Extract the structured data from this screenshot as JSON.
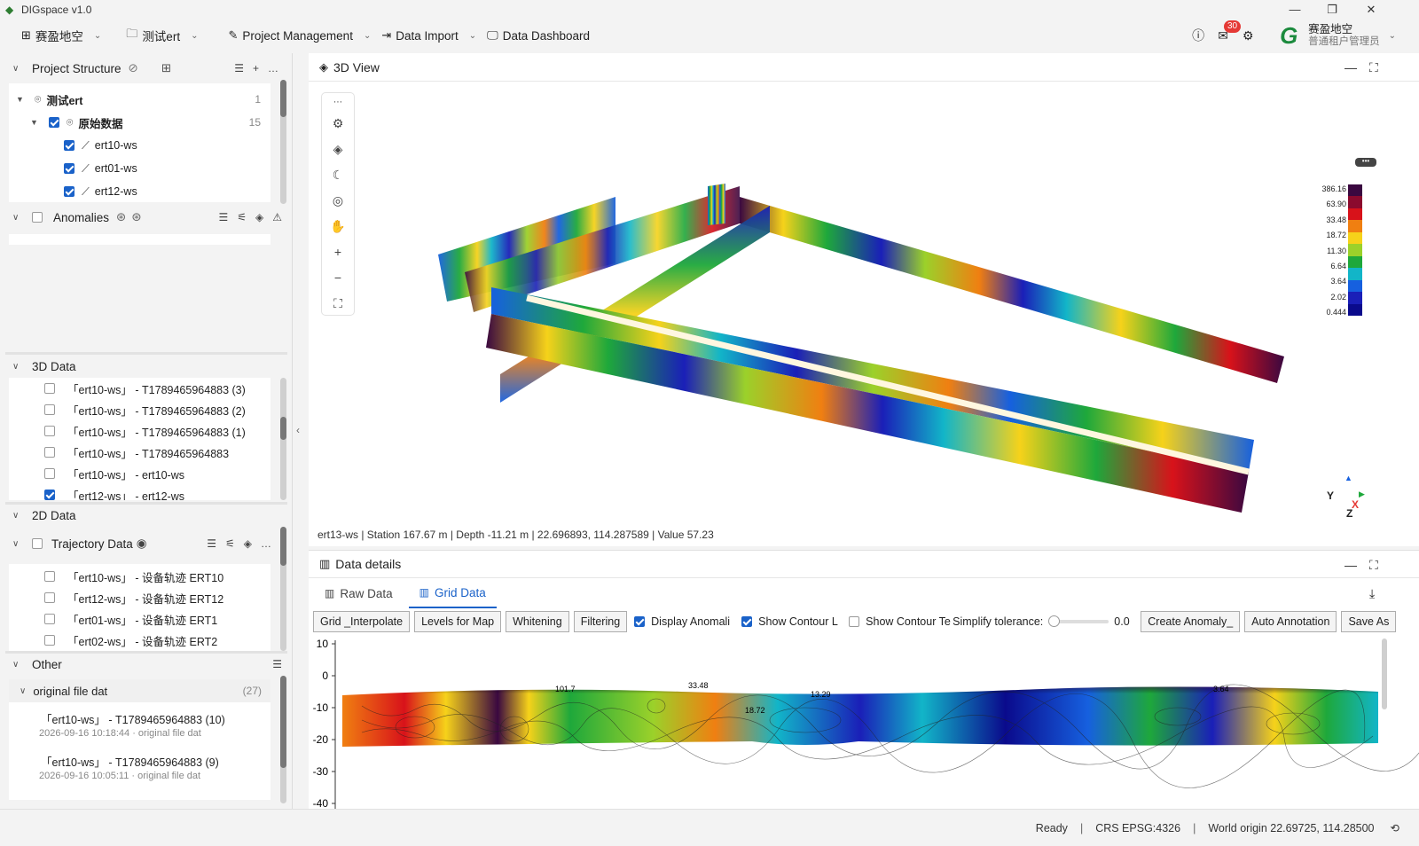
{
  "app": {
    "title": "DIGspace v1.0"
  },
  "window": {
    "minimize": "—",
    "restore": "❐",
    "close": "✕"
  },
  "menu": {
    "workspace": "赛盈地空",
    "project": "测试ert",
    "project_management": "Project Management",
    "data_import": "Data Import",
    "data_dashboard": "Data Dashboard"
  },
  "header": {
    "notif_count": "30",
    "user_name": "赛盈地空",
    "user_role": "普通租户管理员"
  },
  "left": {
    "project_structure": {
      "title": "Project Structure",
      "items": [
        {
          "label": "测试ert",
          "count": "1"
        },
        {
          "label": "原始数据",
          "count": "15"
        },
        {
          "label": "ert10-ws"
        },
        {
          "label": "ert01-ws"
        },
        {
          "label": "ert12-ws"
        }
      ]
    },
    "anomalies": {
      "title": "Anomalies"
    },
    "data3d": {
      "title": "3D Data",
      "items": [
        {
          "label": "「ert10-ws」 - T1789465964883 (3)",
          "checked": false
        },
        {
          "label": "「ert10-ws」 - T1789465964883 (2)",
          "checked": false
        },
        {
          "label": "「ert10-ws」 - T1789465964883 (1)",
          "checked": false
        },
        {
          "label": "「ert10-ws」 - T1789465964883",
          "checked": false
        },
        {
          "label": "「ert10-ws」 - ert10-ws",
          "checked": false
        },
        {
          "label": "「ert12-ws」 - ert12-ws",
          "checked": true
        }
      ]
    },
    "data2d": {
      "title": "2D Data",
      "trajectory": "Trajectory Data",
      "items": [
        {
          "label": "「ert10-ws」 - 设备轨迹 ERT10"
        },
        {
          "label": "「ert12-ws」 - 设备轨迹 ERT12"
        },
        {
          "label": "「ert01-ws」 - 设备轨迹 ERT1"
        },
        {
          "label": "「ert02-ws」 - 设备轨迹 ERT2"
        }
      ]
    },
    "other": {
      "title": "Other",
      "group": "original file dat",
      "group_count": "(27)",
      "items": [
        {
          "label": "「ert10-ws」 - T1789465964883 (10)",
          "sub": "2026-09-16 10:18:44 · original file dat"
        },
        {
          "label": "「ert10-ws」 - T1789465964883 (9)",
          "sub": "2026-09-16 10:05:11 · original file dat"
        }
      ]
    }
  },
  "view3d": {
    "title": "3D View",
    "status": "ert13-ws | Station 167.67 m | Depth -11.21 m | 22.696893, 114.287589 | Value 57.23",
    "colorbar": [
      "386.16",
      "63.90",
      "33.48",
      "18.72",
      "11.30",
      "6.64",
      "3.64",
      "2.02",
      "0.444"
    ],
    "colorbar_colors": [
      "#3a0840",
      "#8b0a2e",
      "#d8121a",
      "#f07f11",
      "#f6d21a",
      "#9bd12a",
      "#1ea83b",
      "#12b5c8",
      "#1660df",
      "#1a1fb8",
      "#0a0a8c"
    ],
    "axes": {
      "y": "Y",
      "x": "X",
      "z": "Z"
    }
  },
  "details": {
    "title": "Data details",
    "tabs": {
      "raw": "Raw Data",
      "grid": "Grid Data"
    },
    "opts": {
      "grid_interpolate": "Grid _Interpolate",
      "levels": "Levels for Map",
      "whitening": "Whitening",
      "filtering": "Filtering",
      "display_anomali": "Display Anomali",
      "show_contour_l": "Show Contour L",
      "show_contour_t": "Show Contour Te",
      "simplify": "Simplify tolerance:",
      "simplify_value": "0.0",
      "create_anomaly": "Create Anomaly_",
      "auto_annotation": "Auto Annotation",
      "save_as": "Save As"
    },
    "yticks": [
      "10",
      "0",
      "-10",
      "-20",
      "-30",
      "-40"
    ],
    "contour_labels": [
      "101.7",
      "33.48",
      "18.72",
      "13.29",
      "3.64"
    ]
  },
  "status": {
    "ready": "Ready",
    "crs": "CRS EPSG:4326",
    "origin": "World origin  22.69725, 114.28500"
  }
}
